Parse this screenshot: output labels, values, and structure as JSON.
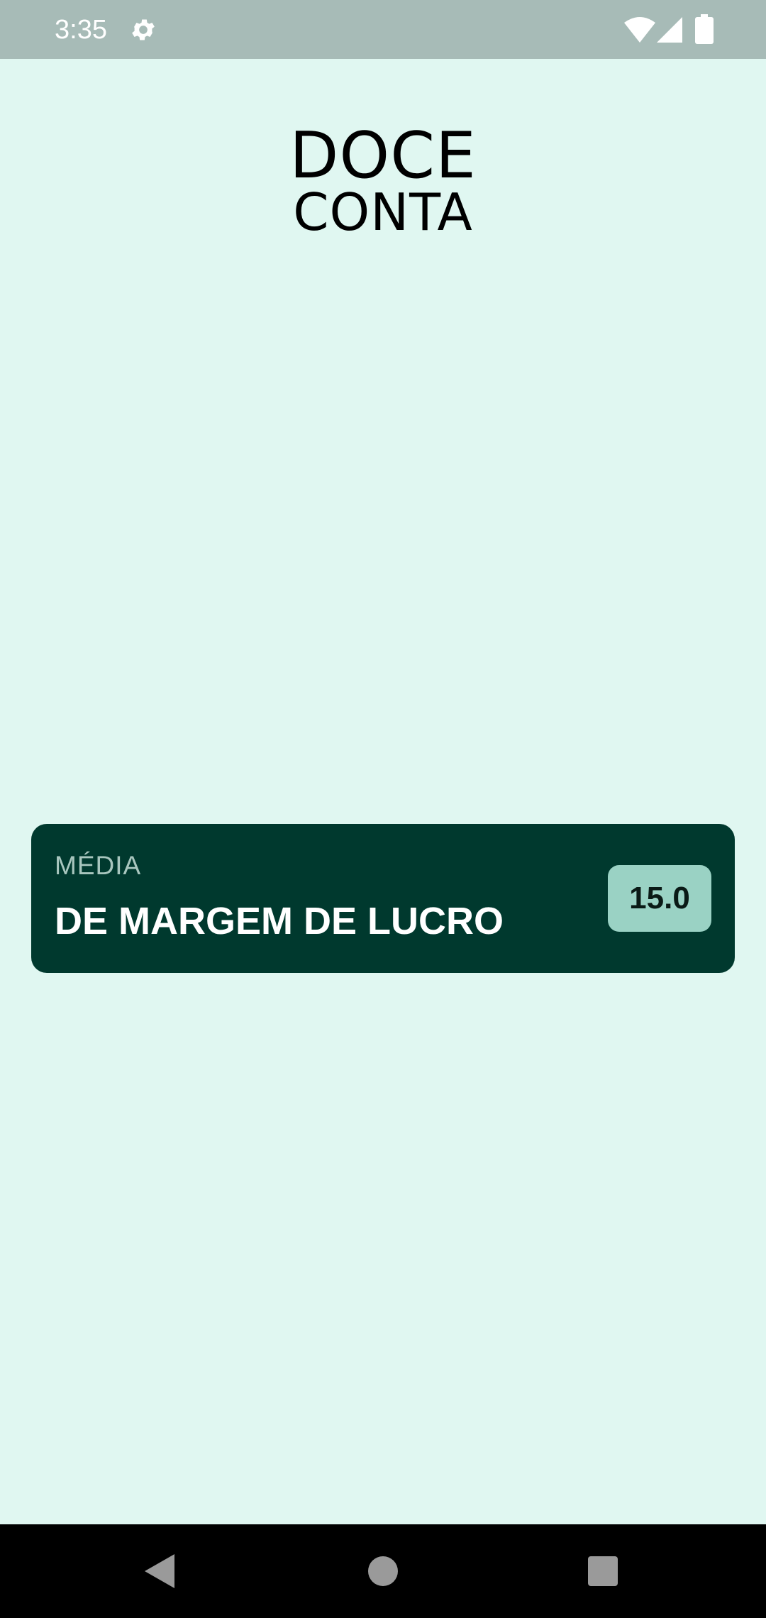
{
  "status_bar": {
    "time": "3:35",
    "icons": [
      "gear-icon",
      "wifi-icon",
      "signal-icon",
      "battery-icon"
    ],
    "background": "#a7bbb7"
  },
  "app": {
    "title_line1": "DOCE",
    "title_line2": "CONTA",
    "background": "#e0f7f1"
  },
  "card": {
    "label_small": "MÉDIA",
    "label_big": "DE MARGEM DE LUCRO",
    "value": "15.0",
    "background": "#00392e",
    "badge_color": "#9ad2c4"
  },
  "nav_bar": {
    "icons": [
      "back-icon",
      "home-icon",
      "recents-icon"
    ]
  }
}
